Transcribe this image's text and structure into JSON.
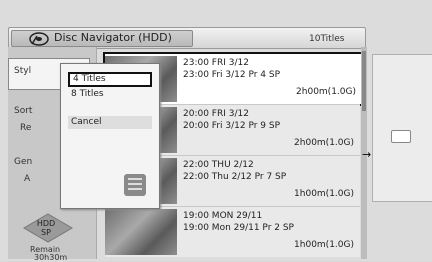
{
  "header": {
    "title": "Disc Navigator (HDD)",
    "title_count": "10Titles"
  },
  "left_panel": {
    "style_label": "Styl",
    "sort_label": "Sort",
    "sort_value": "Re",
    "genre_label": "Gen",
    "genre_value": "A"
  },
  "popup": {
    "items": [
      {
        "label": "4 Titles",
        "selected": true
      },
      {
        "label": "8 Titles",
        "selected": false
      },
      {
        "label": "Cancel",
        "selected": false
      }
    ]
  },
  "titles": [
    {
      "line1": "23:00 FRI 3/12",
      "line2": "23:00 Fri 3/12 Pr 4 SP",
      "duration": "2h00m(1.0G)",
      "active": true
    },
    {
      "line1": "20:00 FRI 3/12",
      "line2": "20:00 Fri 3/12 Pr 9 SP",
      "duration": "2h00m(1.0G)",
      "active": false
    },
    {
      "line1": "22:00 THU 2/12",
      "line2": "22:00 Thu 2/12 Pr 7 SP",
      "duration": "1h00m(1.0G)",
      "active": false
    },
    {
      "line1": "19:00 MON 29/11",
      "line2": "19:00 Mon 29/11 Pr 2 SP",
      "duration": "1h00m(1.0G)",
      "active": false
    }
  ],
  "status": {
    "hdd_line1": "HDD",
    "hdd_line2": "SP",
    "remain_label": "Remain",
    "remain_value": "30h30m"
  }
}
